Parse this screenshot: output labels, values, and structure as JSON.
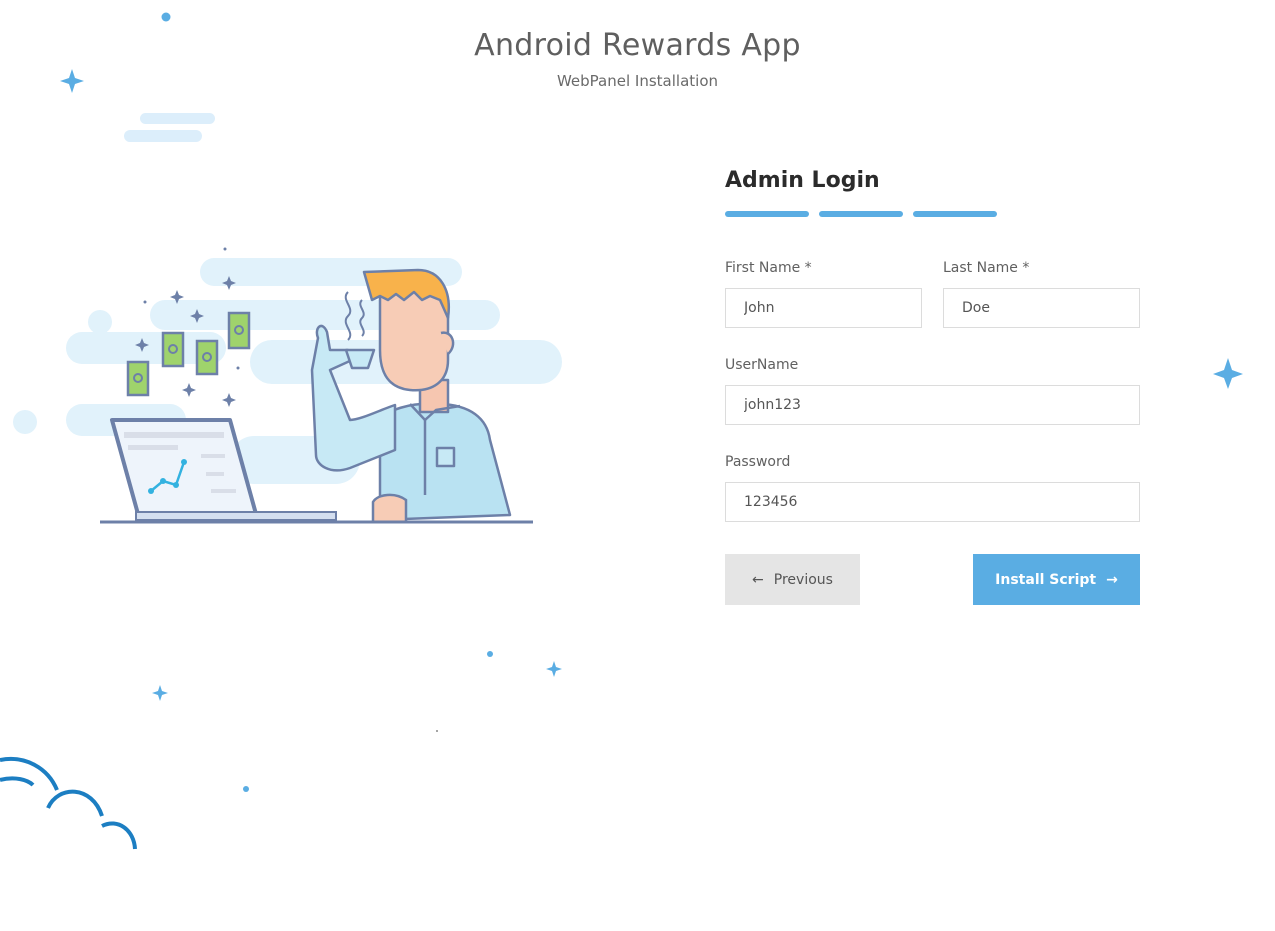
{
  "header": {
    "title": "Android Rewards App",
    "subtitle": "WebPanel Installation"
  },
  "form": {
    "title": "Admin Login",
    "steps": [
      "step-1",
      "step-2",
      "step-3"
    ],
    "first_name": {
      "label": "First Name *",
      "value": "John"
    },
    "last_name": {
      "label": "Last Name *",
      "value": "Doe"
    },
    "username": {
      "label": "UserName",
      "value": "john123"
    },
    "password": {
      "label": "Password",
      "value": "123456"
    },
    "previous_label": "Previous",
    "install_label": "Install Script"
  },
  "icons": {
    "previous": "arrow-left-icon",
    "install": "arrow-right-icon",
    "illustration": "man-drinking-coffee-illustration",
    "decor": [
      "sparkle-icon",
      "cloud-icon",
      "dot-icon"
    ]
  },
  "colors": {
    "accent": "#5aade3",
    "secondary_button": "#e5e5e5",
    "title": "#5f5f5f"
  }
}
